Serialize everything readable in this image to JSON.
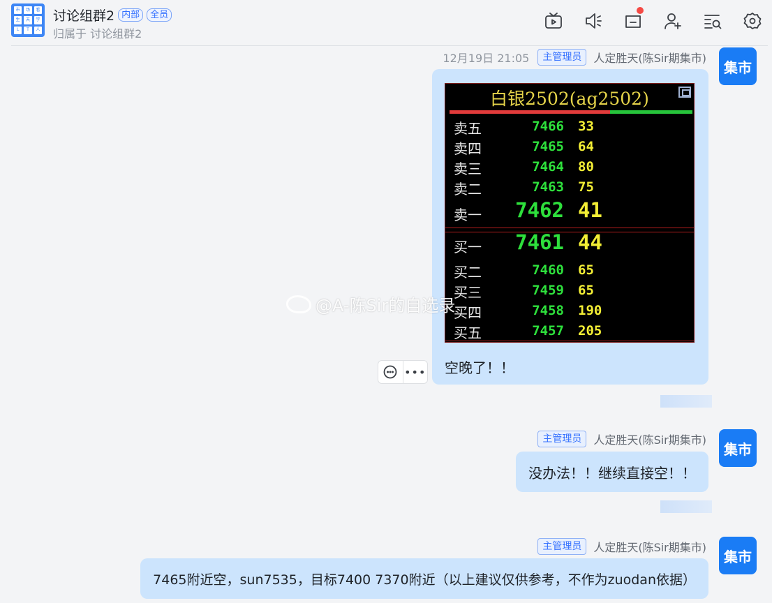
{
  "header": {
    "group_name": "讨论组群2",
    "tags": [
      "内部",
      "全员"
    ],
    "subtitle": "归属于 讨论组群2",
    "avatar_glyphs": [
      "市",
      "场",
      "看",
      "生",
      "天",
      "学",
      "L",
      "T",
      "人"
    ],
    "toolbar_icons": [
      "tv-icon",
      "speaker-icon",
      "inbox-icon",
      "add-member-icon",
      "search-list-icon",
      "settings-icon"
    ]
  },
  "messages": [
    {
      "time": "12月19日 21:05",
      "role": "主管理员",
      "sender": "人定胜天(陈Sir期集市)",
      "avatar_text": "集市",
      "text": "空晚了！！",
      "image": {
        "title": "白银2502(ag2502)",
        "asks": [
          {
            "label": "卖五",
            "price": "7466",
            "volume": "33"
          },
          {
            "label": "卖四",
            "price": "7465",
            "volume": "64"
          },
          {
            "label": "卖三",
            "price": "7464",
            "volume": "80"
          },
          {
            "label": "卖二",
            "price": "7463",
            "volume": "75"
          },
          {
            "label": "卖一",
            "price": "7462",
            "volume": "41"
          }
        ],
        "bids": [
          {
            "label": "买一",
            "price": "7461",
            "volume": "44"
          },
          {
            "label": "买二",
            "price": "7460",
            "volume": "65"
          },
          {
            "label": "买三",
            "price": "7459",
            "volume": "65"
          },
          {
            "label": "买四",
            "price": "7458",
            "volume": "190"
          },
          {
            "label": "买五",
            "price": "7457",
            "volume": "205"
          }
        ],
        "watermark": "@A-陈Sir的自选录"
      }
    },
    {
      "role": "主管理员",
      "sender": "人定胜天(陈Sir期集市)",
      "avatar_text": "集市",
      "text": "没办法！！继续直接空！！"
    },
    {
      "role": "主管理员",
      "sender": "人定胜天(陈Sir期集市)",
      "avatar_text": "集市",
      "text": "7465附近空，sun7535，目标7400 7370附近（以上建议仅供参考，不作为zuodan依据）"
    }
  ],
  "colors": {
    "bubble": "#cce4fd",
    "avatar": "#1a7cf5",
    "accent": "#3370ff",
    "price_green": "#2ee03c",
    "volume_yellow": "#f3ee35"
  }
}
